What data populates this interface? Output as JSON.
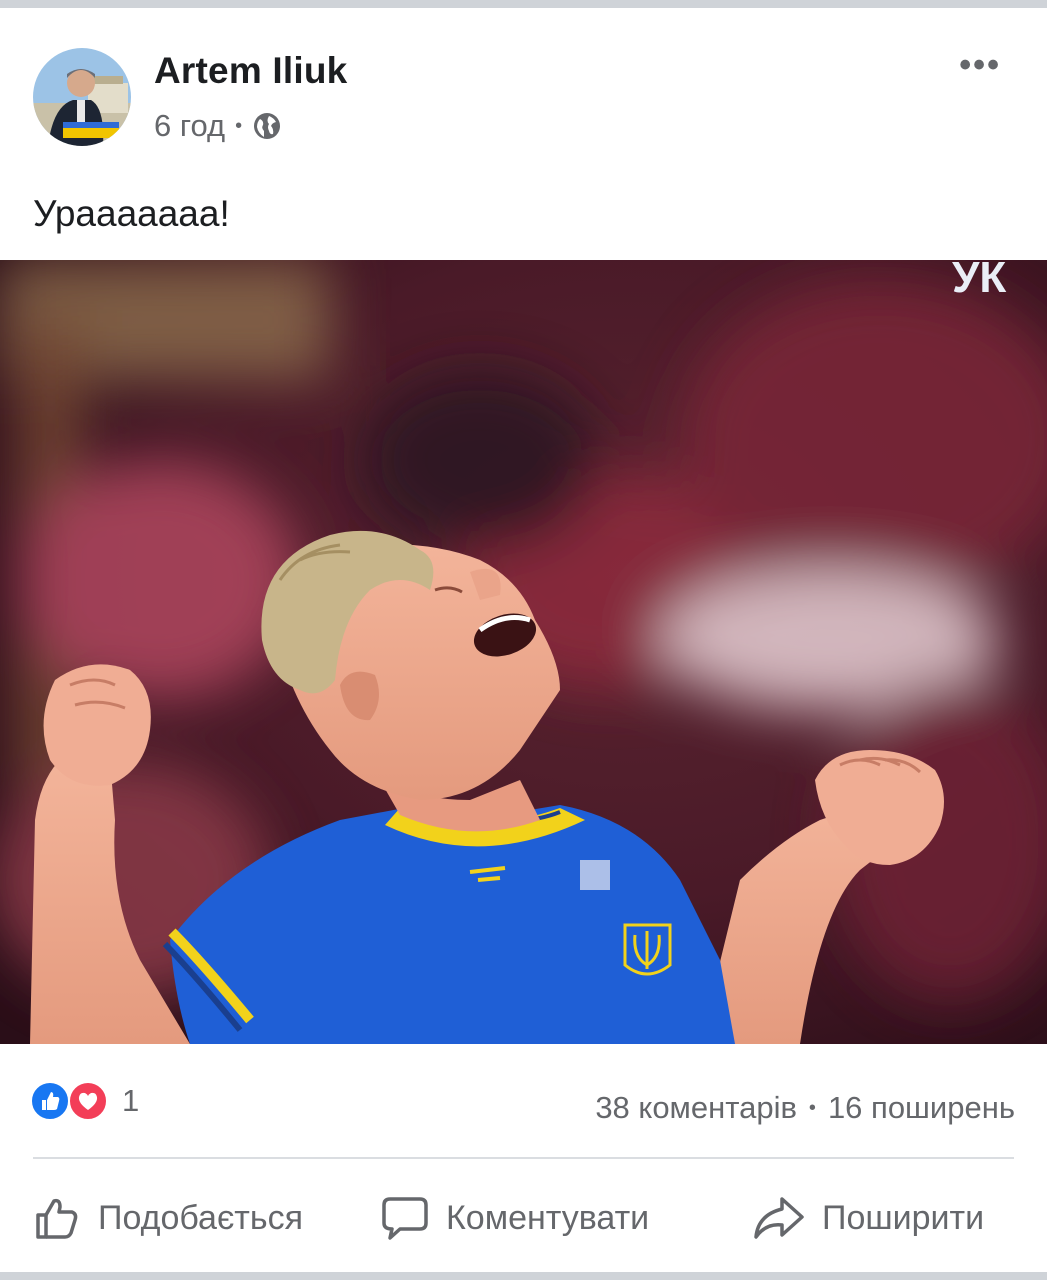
{
  "post": {
    "author_name": "Artem Iliuk",
    "timestamp": "6 год",
    "audience_icon": "globe-icon",
    "text": "Урааааааа!",
    "more_icon": "more-horizontal-icon",
    "more_label": "•••",
    "photo_overlay_text": "УК"
  },
  "reactions": {
    "icons": [
      "like-reaction-icon",
      "love-reaction-icon"
    ],
    "count": "1"
  },
  "stats": {
    "comments": "38 коментарів",
    "shares": "16 поширень"
  },
  "actions": {
    "like_label": "Подобається",
    "comment_label": "Коментувати",
    "share_label": "Поширити"
  },
  "colors": {
    "like_blue": "#1877f2",
    "love_red": "#f33e58",
    "secondary_text": "#65676b",
    "jersey_blue": "#1f5fd6",
    "jersey_yellow": "#f2d21b"
  }
}
